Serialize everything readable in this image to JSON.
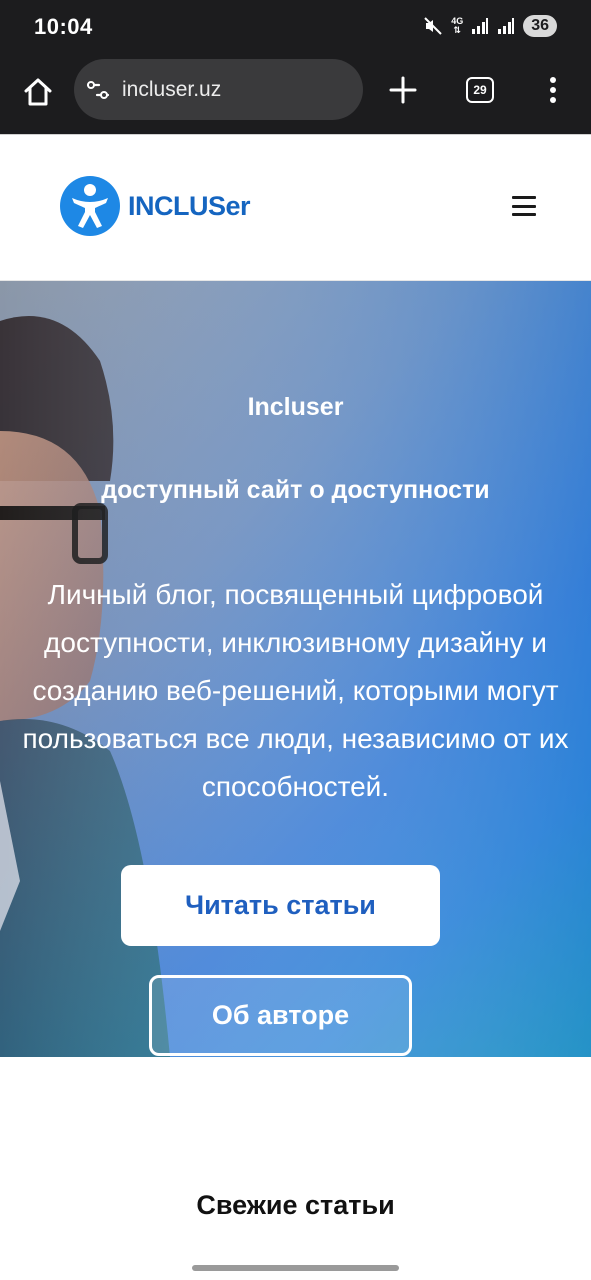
{
  "status_bar": {
    "time": "10:04",
    "network": "4G",
    "battery": "36",
    "icons": [
      "mute-icon",
      "network-4g-icon",
      "signal-icon",
      "signal-icon"
    ]
  },
  "browser": {
    "url": "incluser.uz",
    "tab_count": "29",
    "icons": [
      "home-icon",
      "site-settings-icon",
      "new-tab-icon",
      "tabs-icon",
      "more-menu-icon"
    ]
  },
  "header": {
    "logo_text": "INCLUSer",
    "brand_color": "#1565c0",
    "icons": [
      "accessibility-logo-icon",
      "hamburger-menu-icon"
    ]
  },
  "hero": {
    "title": "Incluser",
    "subtitle": "доступный сайт о доступности",
    "description": "Личный блог, посвященный цифровой доступности, инклюзивному дизайну и созданию веб-решений, которыми могут пользоваться все люди, независимо от их способностей.",
    "primary_button": "Читать статьи",
    "secondary_button": "Об авторе",
    "gradient_colors": [
      "#8b97a8",
      "#3d7dd6",
      "#1fa7b5"
    ]
  },
  "fresh_articles": {
    "title": "Свежие статьи"
  }
}
